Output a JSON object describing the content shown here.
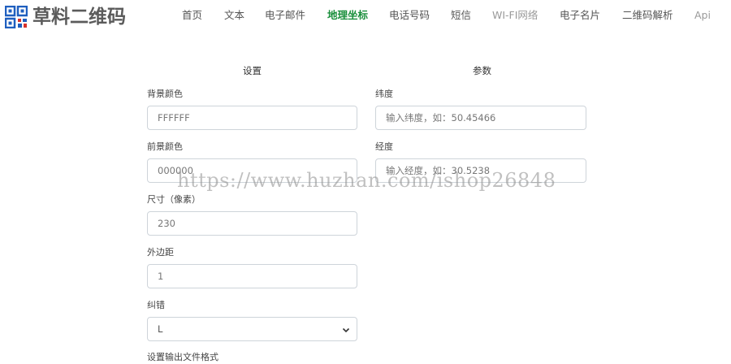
{
  "header": {
    "logo_text": "草料二维码",
    "nav": [
      {
        "label": "首页",
        "state": "normal"
      },
      {
        "label": "文本",
        "state": "normal"
      },
      {
        "label": "电子邮件",
        "state": "normal"
      },
      {
        "label": "地理坐标",
        "state": "active"
      },
      {
        "label": "电话号码",
        "state": "normal"
      },
      {
        "label": "短信",
        "state": "normal"
      },
      {
        "label": "WI-FI网络",
        "state": "muted"
      },
      {
        "label": "电子名片",
        "state": "normal"
      },
      {
        "label": "二维码解析",
        "state": "normal"
      },
      {
        "label": "Api",
        "state": "muted"
      }
    ]
  },
  "settings": {
    "title": "设置",
    "background_color": {
      "label": "背景颜色",
      "value": "FFFFFF"
    },
    "foreground_color": {
      "label": "前景颜色",
      "value": "000000"
    },
    "size": {
      "label": "尺寸（像素）",
      "value": "230"
    },
    "margin": {
      "label": "外边距",
      "value": "1"
    },
    "error_correction": {
      "label": "纠错",
      "value": "L"
    },
    "output_format": {
      "label": "设置输出文件格式"
    }
  },
  "params": {
    "title": "参数",
    "latitude": {
      "label": "纬度",
      "placeholder": "输入纬度，如：50.45466"
    },
    "longitude": {
      "label": "经度",
      "placeholder": "输入经度，如：30.5238"
    }
  },
  "watermark": "https://www.huzhan.com/ishop26848",
  "colors": {
    "accent": "#1a8f3c",
    "border": "#ced4da",
    "logo_blue": "#1f5fbf",
    "logo_red": "#d9322b"
  }
}
